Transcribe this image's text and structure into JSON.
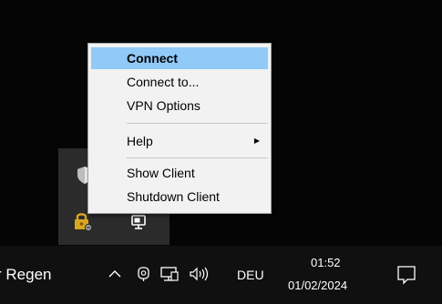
{
  "context_menu": {
    "items": [
      {
        "label": "Connect",
        "selected": true
      },
      {
        "label": "Connect to..."
      },
      {
        "label": "VPN Options"
      },
      {
        "label": "Help",
        "has_submenu": true
      },
      {
        "label": "Show Client"
      },
      {
        "label": "Shutdown Client"
      }
    ],
    "highlight_color": "#91c9f7"
  },
  "tray_flyout": {
    "icons": [
      "shield-icon",
      "vpn-lock-icon",
      "monitor-icon"
    ]
  },
  "taskbar": {
    "weather_text": "r Regen",
    "tray_icons": [
      "chevron-up-icon",
      "meet-now-icon",
      "network-icon",
      "volume-icon"
    ],
    "language": "DEU",
    "time": "01:52",
    "date": "01/02/2024",
    "notification_icon": "notification-icon"
  }
}
